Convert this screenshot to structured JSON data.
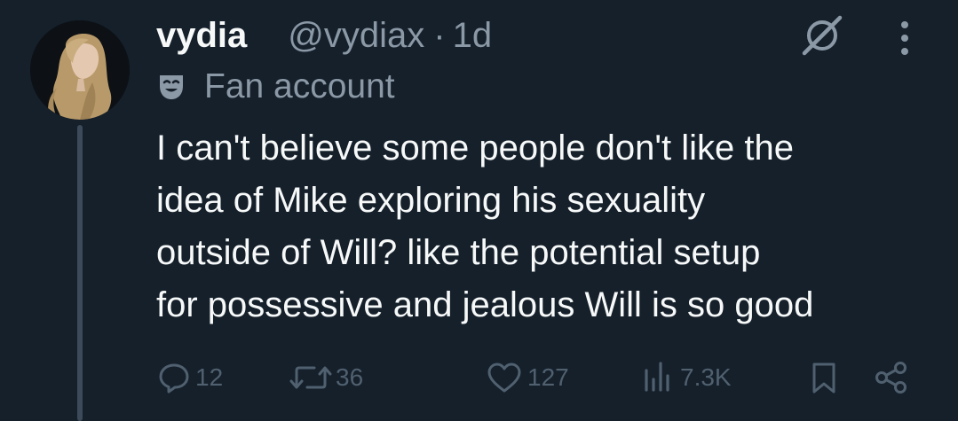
{
  "tweet": {
    "author": {
      "display_name": "vydia",
      "handle": "@vydiax",
      "separator": "·",
      "time": "1d"
    },
    "account_label": {
      "icon": "theater-mask-icon",
      "text": "Fan account"
    },
    "text_lines": [
      "I can't believe some people don't like the",
      "idea of Mike exploring his sexuality",
      "outside of Will? like the potential setup",
      "for possessive and jealous Will is so good"
    ],
    "actions": {
      "replies": "12",
      "reposts": "36",
      "likes": "127",
      "views": "7.3K"
    }
  },
  "colors": {
    "background": "#15202b",
    "primary_text": "#f7f9f9",
    "secondary_text": "#8b98a5",
    "action_icons": "#50606f",
    "thread_line": "#3c4a59"
  },
  "icons": [
    "grok-icon",
    "more-options-icon",
    "reply-icon",
    "repost-icon",
    "like-icon",
    "views-icon",
    "bookmark-icon",
    "share-icon"
  ]
}
